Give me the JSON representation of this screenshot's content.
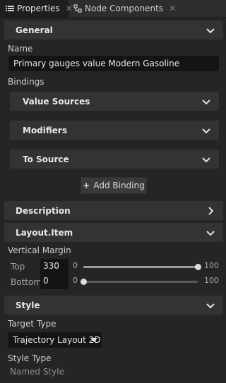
{
  "tabs": [
    {
      "label": "Properties",
      "icon": "list-icon",
      "active": true
    },
    {
      "label": "Node Components",
      "icon": "components-icon",
      "active": false
    }
  ],
  "general": {
    "header": "General",
    "name_label": "Name",
    "name_value": "Primary gauges value Modern Gasoline",
    "bindings_label": "Bindings",
    "value_sources": "Value Sources",
    "modifiers": "Modifiers",
    "to_source": "To Source",
    "add_binding": "Add Binding"
  },
  "description": {
    "header": "Description"
  },
  "layout_item": {
    "header": "Layout.Item",
    "vertical_margin_label": "Vertical Margin",
    "top": {
      "label": "Top",
      "value": "330",
      "min": "0",
      "max": "100",
      "slider_fraction": 1.0
    },
    "bottom": {
      "label": "Bottom",
      "value": "0",
      "min": "0",
      "max": "100",
      "slider_fraction": 0.0
    }
  },
  "style": {
    "header": "Style",
    "target_type_label": "Target Type",
    "target_type_value": "Trajectory Layout 2D",
    "style_type_label": "Style Type",
    "style_type_value": "Named Style"
  }
}
